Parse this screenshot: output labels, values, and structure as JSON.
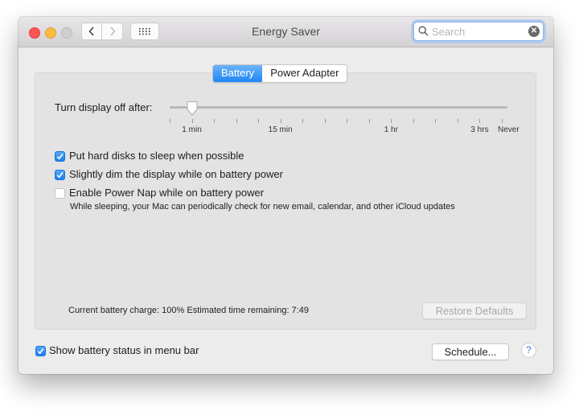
{
  "window": {
    "title": "Energy Saver",
    "controls": [
      "close",
      "minimize",
      "zoom"
    ]
  },
  "toolbar": {
    "back_icon": "chevron-left-icon",
    "forward_icon": "chevron-right-icon",
    "grid_icon": "show-all-grid-icon",
    "search": {
      "value": "",
      "placeholder": "Search",
      "clear_icon": "clear-x-icon"
    }
  },
  "tabs": [
    {
      "label": "Battery",
      "active": true
    },
    {
      "label": "Power Adapter",
      "active": false
    }
  ],
  "display_sleep": {
    "label": "Turn display off after:",
    "value": "1 min",
    "tick_count": 16,
    "selected_tick_index": 1,
    "tick_labels": [
      {
        "label": "1 min",
        "tick_index": 1
      },
      {
        "label": "15 min",
        "tick_index": 5
      },
      {
        "label": "1 hr",
        "tick_index": 10
      },
      {
        "label": "3 hrs",
        "tick_index": 14
      },
      {
        "label": "Never",
        "tick_index": 15
      }
    ]
  },
  "options": [
    {
      "label": "Put hard disks to sleep when possible",
      "checked": true
    },
    {
      "label": "Slightly dim the display while on battery power",
      "checked": true
    },
    {
      "label": "Enable Power Nap while on battery power",
      "checked": false
    }
  ],
  "power_nap_description": "While sleeping, your Mac can periodically check for new email, calendar, and other iCloud updates",
  "status": {
    "text": "Current battery charge: 100%  Estimated time remaining: 7:49",
    "battery_charge": "100%",
    "time_remaining": "7:49"
  },
  "buttons": {
    "restore_defaults": "Restore Defaults",
    "restore_defaults_enabled": false,
    "schedule": "Schedule...",
    "help": "?"
  },
  "footer": {
    "show_battery_status": {
      "label": "Show battery status in menu bar",
      "checked": true
    }
  }
}
